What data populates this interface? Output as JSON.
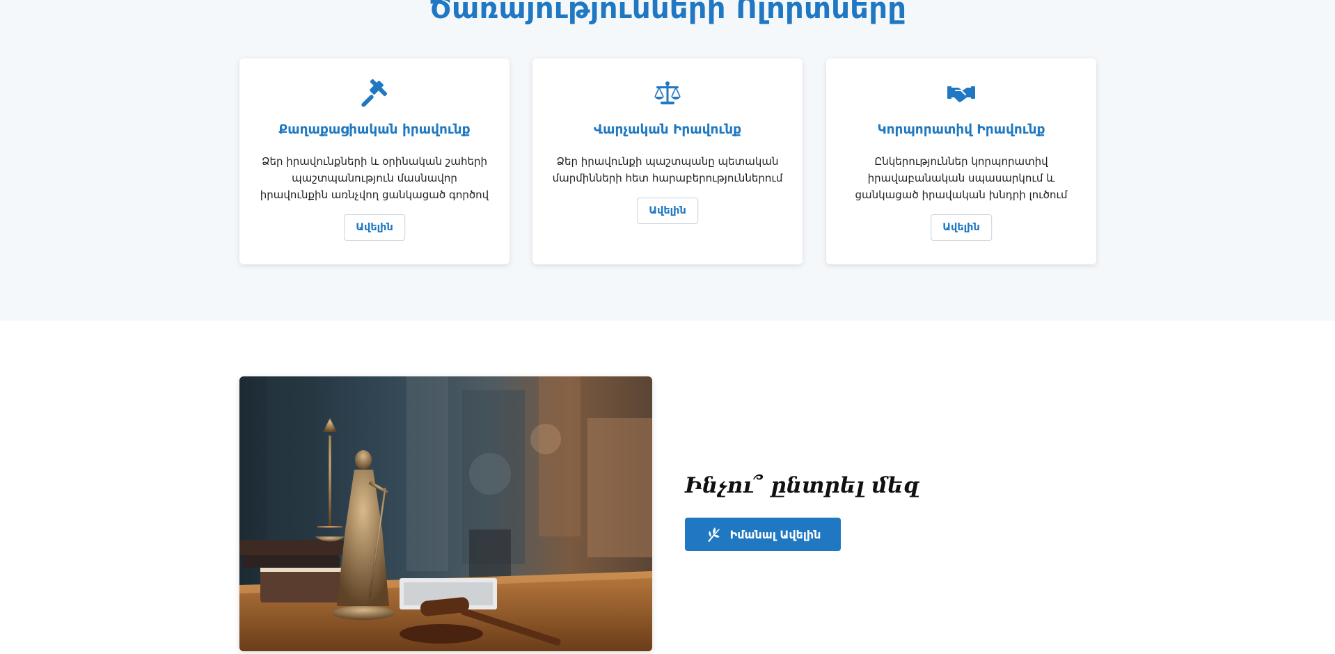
{
  "services": {
    "title": "Ծառայությունների Ոլորտները",
    "cards": [
      {
        "icon": "gavel-icon",
        "title": "Քաղաքացիական իրավունք",
        "text": "Ձեր իրավունքների և օրինական շահերի պաշտպանություն մասնավոր իրավունքին առնչվող ցանկացած գործով",
        "button": "Ավելին"
      },
      {
        "icon": "scales-icon",
        "title": "Վարչական Իրավունք",
        "text": "Ձեր իրավունքի պաշտպանը պետական մարմինների հետ հարաբերություններում",
        "button": "Ավելին"
      },
      {
        "icon": "handshake-icon",
        "title": "Կորպորատիվ Իրավունք",
        "text": "Ընկերություններ կորպորատիվ իրավաբանական սպասարկում և ցանկացած իրավական խնդրի լուծում",
        "button": "Ավելին"
      }
    ]
  },
  "why": {
    "title": "Ինչու՞ ընտրել մեզ",
    "button": "Իմանալ Ավելին",
    "button_icon": "leaf-icon",
    "image": "lady-justice-statue-photo"
  },
  "colors": {
    "accent": "#1f78c1",
    "section_bg": "#f5f8fb",
    "card_bg": "#ffffff",
    "heading_dark": "#111111"
  }
}
